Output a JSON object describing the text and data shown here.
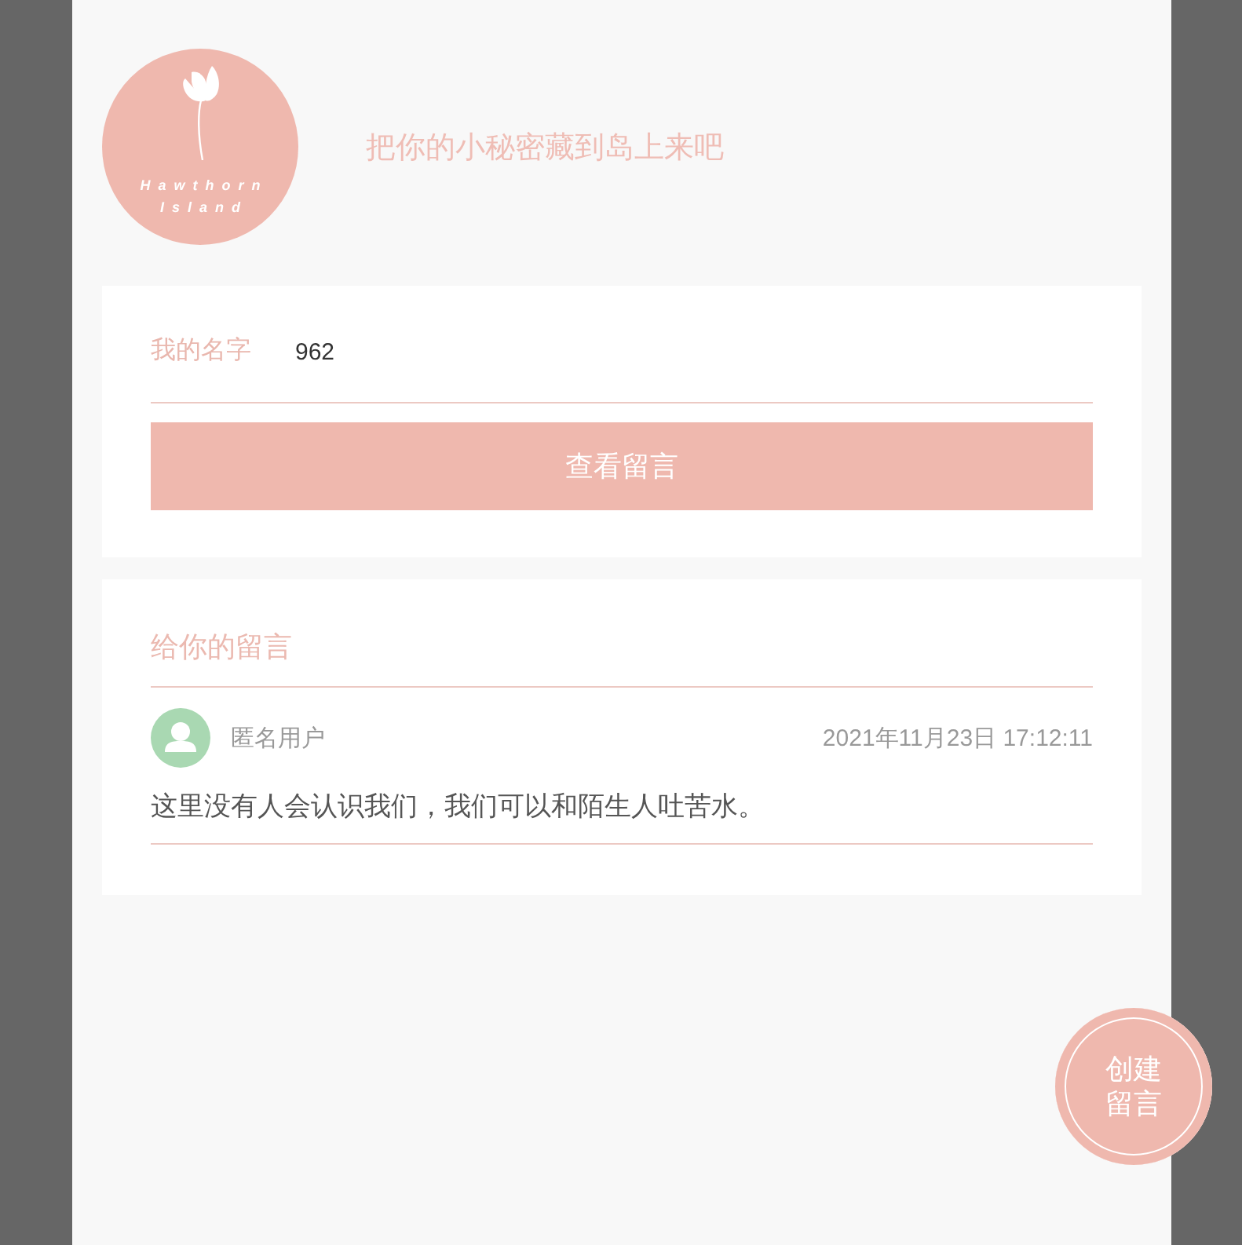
{
  "header": {
    "logo": {
      "lines": [
        "Hawthorn",
        "Island"
      ]
    },
    "tagline": "把你的小秘密藏到岛上来吧"
  },
  "name_form": {
    "label": "我的名字",
    "value": "962",
    "button": "查看留言"
  },
  "messages": {
    "title": "给你的留言",
    "items": [
      {
        "author": "匿名用户",
        "time": "2021年11月23日 17:12:11",
        "text": "这里没有人会认识我们，我们可以和陌生人吐苦水。"
      }
    ]
  },
  "create_button": {
    "label": "创建留言"
  }
}
